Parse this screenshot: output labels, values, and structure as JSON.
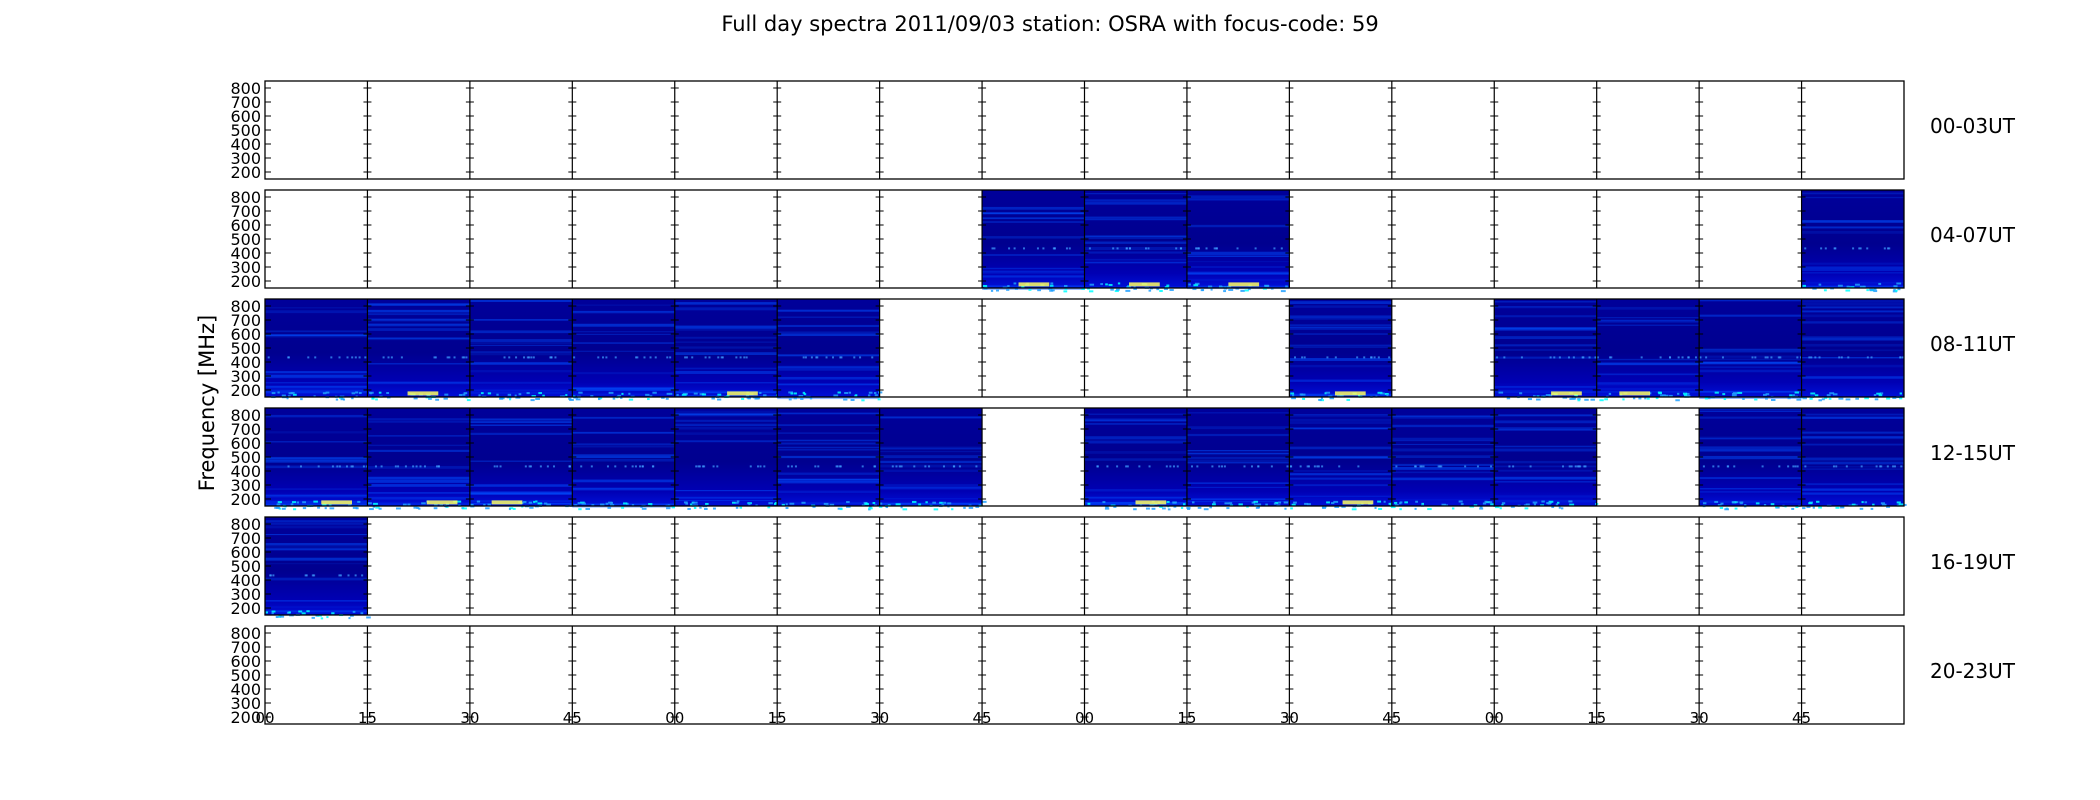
{
  "chart_data": {
    "type": "heatmap",
    "title": "Full day spectra 2011/09/03 station: OSRA with focus-code: 59",
    "xlabel": "",
    "ylabel": "Frequency [MHz]",
    "yticks": [
      200,
      300,
      400,
      500,
      600,
      700,
      800
    ],
    "ylim": [
      150,
      850
    ],
    "xticks": [
      "00",
      "15",
      "30",
      "45",
      "00",
      "15",
      "30",
      "45",
      "00",
      "15",
      "30",
      "45",
      "00",
      "15",
      "30",
      "45"
    ],
    "columns_per_row": 16,
    "column_minutes": 15,
    "rows": [
      {
        "label": "00-03UT",
        "filled": []
      },
      {
        "label": "04-07UT",
        "filled": [
          7,
          8,
          9,
          15
        ]
      },
      {
        "label": "08-11UT",
        "filled": [
          0,
          1,
          2,
          3,
          4,
          5,
          10,
          12,
          13,
          14,
          15
        ]
      },
      {
        "label": "12-15UT",
        "filled": [
          0,
          1,
          2,
          3,
          4,
          5,
          6,
          8,
          9,
          10,
          11,
          12,
          14,
          15
        ]
      },
      {
        "label": "16-19UT",
        "filled": [
          0
        ]
      },
      {
        "label": "20-23UT",
        "filled": []
      }
    ],
    "colormap": {
      "low": "#00008f",
      "mid": "#0050ff",
      "high": "#ffff60"
    }
  }
}
